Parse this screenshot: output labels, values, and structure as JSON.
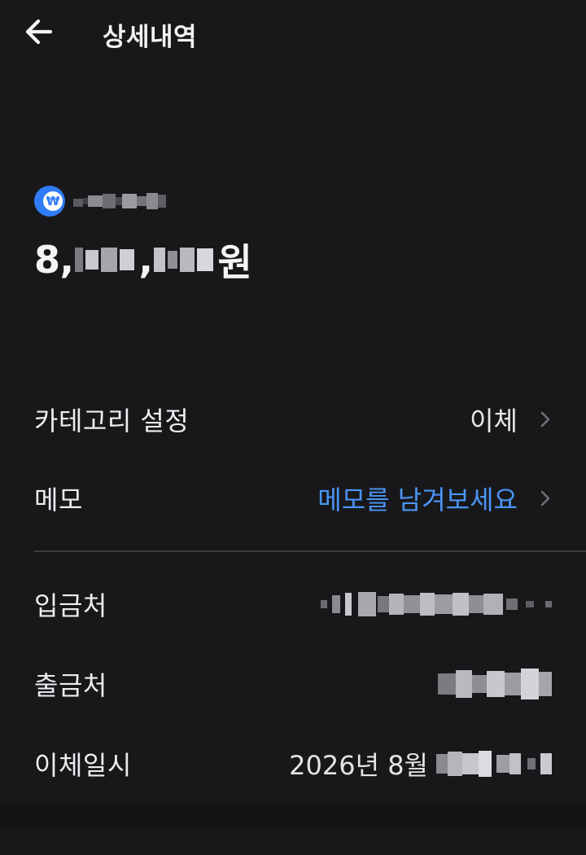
{
  "header": {
    "title": "상세내역",
    "back_icon": "arrow-left-icon"
  },
  "account": {
    "logo_icon": "bank-logo-icon",
    "logo_glyph": "₩",
    "logo_color": "#2f7cf6"
  },
  "amount": {
    "prefix": "8,",
    "separator": ",",
    "suffix": "원"
  },
  "rows": {
    "category": {
      "label": "카테고리 설정",
      "value": "이체"
    },
    "memo": {
      "label": "메모",
      "placeholder": "메모를 남겨보세요",
      "accent_color": "#4a95f5"
    },
    "deposit_to": {
      "label": "입금처"
    },
    "withdraw_from": {
      "label": "출금처"
    },
    "transfer_datetime": {
      "label": "이체일시",
      "value": "2026년 8월"
    }
  },
  "theme": {
    "background": "#18181b",
    "text": "#f2f2f4"
  }
}
